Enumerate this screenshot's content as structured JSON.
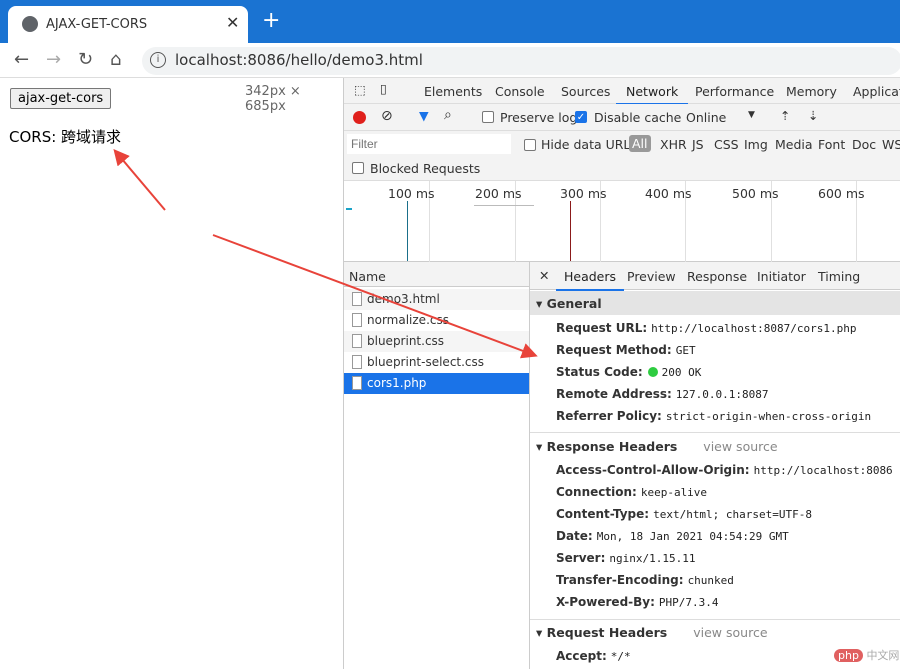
{
  "browser": {
    "tab_title": "AJAX-GET-CORS",
    "url": "localhost:8086/hello/demo3.html"
  },
  "page": {
    "button_label": "ajax-get-cors",
    "dimensions": "342px × 685px",
    "text": "CORS: 跨域请求"
  },
  "devtools": {
    "tabs": [
      "Elements",
      "Console",
      "Sources",
      "Network",
      "Performance",
      "Memory",
      "Applicati"
    ],
    "active_tab": "Network",
    "toolbar": {
      "preserve_log": "Preserve log",
      "disable_cache": "Disable cache",
      "throttle": "Online"
    },
    "filter": {
      "placeholder": "Filter",
      "hide_data_urls": "Hide data URLs",
      "types": [
        "All",
        "XHR",
        "JS",
        "CSS",
        "Img",
        "Media",
        "Font",
        "Doc",
        "WS"
      ],
      "blocked": "Blocked Requests"
    },
    "timeline": [
      "100 ms",
      "200 ms",
      "300 ms",
      "400 ms",
      "500 ms",
      "600 ms"
    ],
    "requests": {
      "header": "Name",
      "items": [
        "demo3.html",
        "normalize.css",
        "blueprint.css",
        "blueprint-select.css",
        "cors1.php"
      ],
      "selected": "cors1.php"
    },
    "detail_tabs": [
      "Headers",
      "Preview",
      "Response",
      "Initiator",
      "Timing"
    ],
    "general": {
      "title": "General",
      "rows": [
        [
          "Request URL:",
          "http://localhost:8087/cors1.php"
        ],
        [
          "Request Method:",
          "GET"
        ],
        [
          "Status Code:",
          "200 OK"
        ],
        [
          "Remote Address:",
          "127.0.0.1:8087"
        ],
        [
          "Referrer Policy:",
          "strict-origin-when-cross-origin"
        ]
      ]
    },
    "response_headers": {
      "title": "Response Headers",
      "view_source": "view source",
      "rows": [
        [
          "Access-Control-Allow-Origin:",
          "http://localhost:8086"
        ],
        [
          "Connection:",
          "keep-alive"
        ],
        [
          "Content-Type:",
          "text/html; charset=UTF-8"
        ],
        [
          "Date:",
          "Mon, 18 Jan 2021 04:54:29 GMT"
        ],
        [
          "Server:",
          "nginx/1.15.11"
        ],
        [
          "Transfer-Encoding:",
          "chunked"
        ],
        [
          "X-Powered-By:",
          "PHP/7.3.4"
        ]
      ]
    },
    "request_headers": {
      "title": "Request Headers",
      "view_source": "view source",
      "rows": [
        [
          "Accept:",
          "*/*"
        ]
      ]
    }
  },
  "watermark": "php 中文网",
  "colors": {
    "chrome_blue": "#1a73d2",
    "accent": "#1a73e8",
    "annotation_arrow": "#e8433a",
    "status_ok": "#2ecc40"
  }
}
